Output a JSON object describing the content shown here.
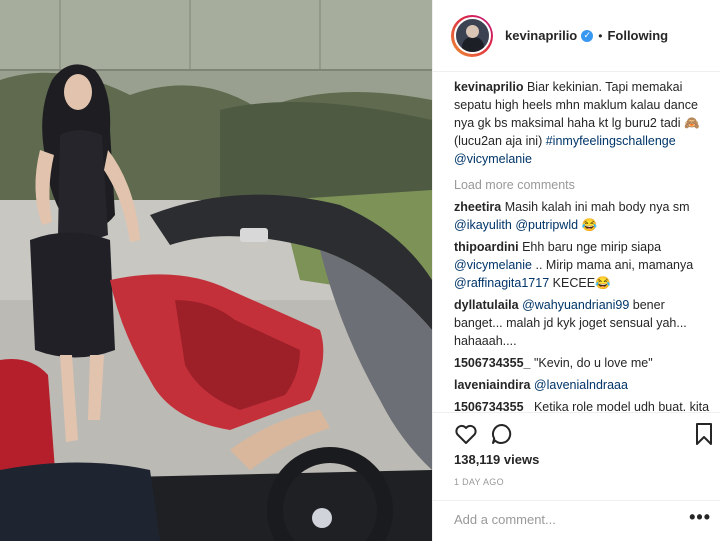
{
  "post": {
    "username": "kevinaprilio",
    "separator": "•",
    "follow_status": "Following",
    "caption_user": "kevinaprilio",
    "caption_text": "Biar kekinian. Tapi memakai sepatu high heels mhn maklum kalau dance nya gk bs maksimal haha kt lg buru2 tadi 🙈 (lucu2an aja ini)",
    "caption_hashtag": "#inmyfeelingschallenge",
    "caption_mention": "@vicymelanie",
    "load_more": "Load more comments",
    "views": "138,119 views",
    "date": "1 DAY AGO",
    "add_comment_placeholder": "Add a comment...",
    "more_options": "•••"
  },
  "comments": [
    {
      "user": "zheetira",
      "text": "Masih kalah ini mah body nya sm",
      "mention1": "@ikayulith",
      "mention2": "@putripwld",
      "tail": "😂"
    },
    {
      "user": "thipoardini",
      "text": "Ehh baru nge mirip siapa",
      "mention1": "@vicymelanie",
      "mid": ".. Mirip mama ani, mamanya",
      "mention2": "@raffinagita1717",
      "tail": "KECEE😂"
    },
    {
      "user": "dyllatulaila",
      "mention1": "@wahyuandriani99",
      "text": "bener banget... malah jd kyk joget sensual yah... hahaaah...."
    },
    {
      "user": "1506734355_",
      "text": "\"Kevin, do u love me\""
    },
    {
      "user": "laveniaindira",
      "mention1": "@lavenialndraaa"
    },
    {
      "user": "1506734355_",
      "text": "Ketika role model udh buat, kita jg harus buat, bikin versi KRL yuk"
    }
  ],
  "icons": {
    "like": "heart-icon",
    "comment": "comment-icon",
    "save": "bookmark-icon",
    "verified": "verified-badge-icon"
  },
  "colors": {
    "link": "#003569",
    "muted": "#999999",
    "verified": "#3897f0"
  }
}
